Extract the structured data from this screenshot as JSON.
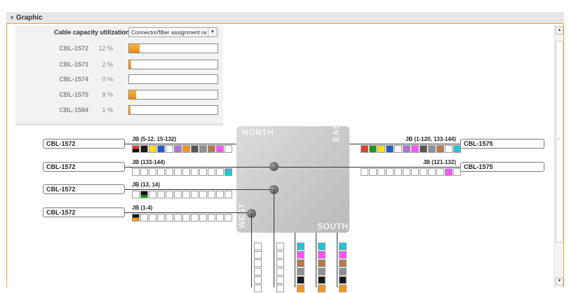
{
  "panel": {
    "title": "Graphic",
    "toggle_icon": "triangle-down-icon"
  },
  "capacity": {
    "title": "Cable capacity utilization",
    "select_value": "Connector/fiber assignment ra",
    "rows": [
      {
        "cable": "CBL-1572",
        "percent": "12 %",
        "fill": 0.12
      },
      {
        "cable": "CBL-1573",
        "percent": "2 %",
        "fill": 0.02
      },
      {
        "cable": "CBL-1574",
        "percent": "0 %",
        "fill": 0.0
      },
      {
        "cable": "CBL-1575",
        "percent": "8 %",
        "fill": 0.08
      },
      {
        "cable": "CBL-1584",
        "percent": "1 %",
        "fill": 0.01
      }
    ]
  },
  "junction": {
    "north": "NORTH",
    "south": "SOUTH",
    "east": "EAST",
    "west": "WEST"
  },
  "west_cables": [
    {
      "cable": "CBL-1572",
      "jb": "JB (5-12, 15-132)"
    },
    {
      "cable": "CBL-1572",
      "jb": "JB (133-144)"
    },
    {
      "cable": "CBL-1572",
      "jb": "JB (13, 14)"
    },
    {
      "cable": "CBL-1572",
      "jb": "JB (1-4)"
    }
  ],
  "east_cables": [
    {
      "cable": "CBL-1575",
      "jb": "JB (1-120, 133-144)"
    },
    {
      "cable": "CBL-1575",
      "jb": "JB (121-132)"
    }
  ],
  "colors": {
    "accent": "#f0a030",
    "fiber": [
      "#f7941d",
      "#1a9c1a",
      "#f5e400",
      "#1f5fd6",
      "#ffffff",
      "#b073d6",
      "#f7941d",
      "#555555",
      "#909090",
      "#b57a4c",
      "#ff55ff",
      "#22c4d6"
    ]
  }
}
